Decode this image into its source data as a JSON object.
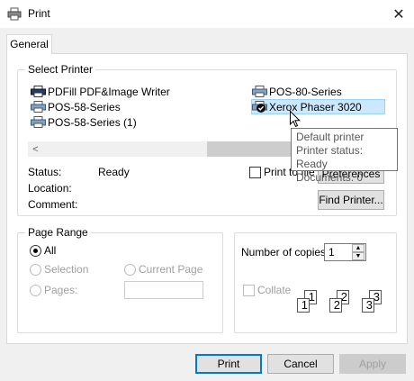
{
  "window": {
    "title": "Print",
    "icon": "printer-icon",
    "close_glyph": "✕"
  },
  "tabs": [
    {
      "label": "General",
      "active": true
    }
  ],
  "select_printer": {
    "legend": "Select Printer",
    "printers": [
      {
        "name": "PDFill PDF&Image Writer",
        "icon": "printer-icon"
      },
      {
        "name": "POS-58-Series",
        "icon": "printer-icon"
      },
      {
        "name": "POS-58-Series (1)",
        "icon": "printer-icon"
      },
      {
        "name": "POS-80-Series",
        "icon": "printer-icon"
      },
      {
        "name": "Xerox Phaser 3020",
        "icon": "default-printer-icon",
        "selected": true
      }
    ],
    "scroll_left_glyph": "<",
    "tooltip": {
      "line1": "Default printer",
      "line2": "Printer status: Ready",
      "line3": "Documents: 0"
    },
    "status_label": "Status:",
    "status_value": "Ready",
    "location_label": "Location:",
    "comment_label": "Comment:",
    "print_to_file_label": "Print to file",
    "preferences_label": "Preferences",
    "find_printer_label": "Find Printer..."
  },
  "page_range": {
    "legend": "Page Range",
    "all_label": "All",
    "selection_label": "Selection",
    "current_page_label": "Current Page",
    "pages_label": "Pages:",
    "selected": "all"
  },
  "copies": {
    "label": "Number of copies:",
    "value": "1",
    "collate_label": "Collate",
    "collate_pages": [
      "1",
      "1",
      "2",
      "2",
      "3",
      "3"
    ]
  },
  "footer": {
    "print_label": "Print",
    "cancel_label": "Cancel",
    "apply_label": "Apply"
  },
  "colors": {
    "accent": "#0078d7",
    "selection": "#cce8ff",
    "dialog_bg": "#f0f0f0"
  }
}
